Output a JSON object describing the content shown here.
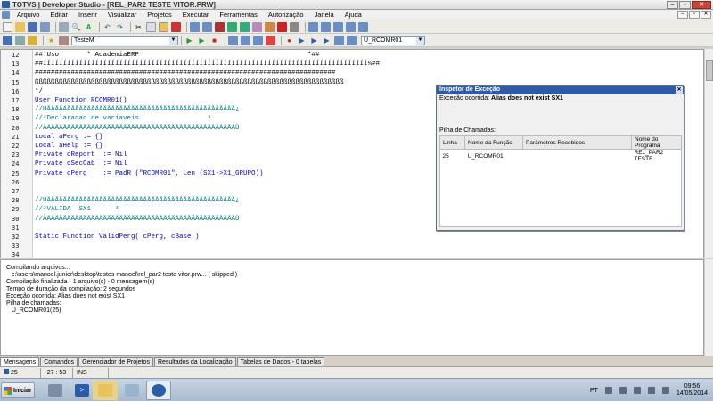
{
  "window": {
    "title": "TOTVS | Developer Studio - [REL_PAR2 TESTE VITOR.PRW]",
    "controls": [
      "–",
      "▫",
      "✕"
    ]
  },
  "menu": [
    "Arquivo",
    "Editar",
    "Inserir",
    "Visualizar",
    "Projetos",
    "Executar",
    "Ferramentas",
    "Autorização",
    "Janela",
    "Ajuda"
  ],
  "toolbar": {
    "environment_value": "TesteM",
    "function_value": "U_RCOMR01"
  },
  "editor": {
    "lines": [
      {
        "n": "12",
        "text": "##'Uso       * AcademiaERP                                          *##",
        "color": "#000000"
      },
      {
        "n": "13",
        "text": "##ÍÍÍÍÍÍÍÍÍÍÍÍÍÍÍÍÍÍÍÍÍÍÍÍÍÍÍÍÍÍÍÍÍÍÍÍÍÍÍÍÍÍÍÍÍÍÍÍÍÍÍÍÍÍÍÍÍÍÍÍÍÍÍÍÍÍÍÍÍÍÍÍÍÍÍÍÍÍÍÍÍ¼##",
        "color": "#000000"
      },
      {
        "n": "14",
        "text": "###########################################################################",
        "color": "#000000"
      },
      {
        "n": "15",
        "text": "ßßßßßßßßßßßßßßßßßßßßßßßßßßßßßßßßßßßßßßßßßßßßßßßßßßßßßßßßßßßßßßßßßßßßßßßßßßßßß",
        "color": "#000000"
      },
      {
        "n": "16",
        "text": "*/",
        "color": "#000000"
      },
      {
        "n": "17",
        "text": "User Function RCOMR01()",
        "color": "#0000c8"
      },
      {
        "n": "18",
        "text": "//ÚÄÄÄÄÄÄÄÄÄÄÄÄÄÄÄÄÄÄÄÄÄÄÄÄÄÄÄÄÄÄÄÄÄÄÄÄÄÄÄÄÄÄÄÄÄÄÄ¿",
        "color": "#007a7a"
      },
      {
        "n": "19",
        "text": "//³Declaracao de variaveis                 ³",
        "color": "#007a7a"
      },
      {
        "n": "20",
        "text": "//ÀÄÄÄÄÄÄÄÄÄÄÄÄÄÄÄÄÄÄÄÄÄÄÄÄÄÄÄÄÄÄÄÄÄÄÄÄÄÄÄÄÄÄÄÄÄÄÄÙ",
        "color": "#007a7a"
      },
      {
        "n": "21",
        "text": "Local aPerg := {}",
        "color": "#0000c8"
      },
      {
        "n": "22",
        "text": "Local aHelp := {}",
        "color": "#0000c8"
      },
      {
        "n": "23",
        "text": "Private oReport  := Nil",
        "color": "#0000c8"
      },
      {
        "n": "24",
        "text": "Private oSecCab  := Nil",
        "color": "#0000c8"
      },
      {
        "n": "25",
        "text": "Private cPerg    := PadR (\"RCOMR01\", Len (SX1->X1_GRUPO))",
        "color": "#0000c8"
      },
      {
        "n": "26",
        "text": "",
        "color": "#000000"
      },
      {
        "n": "27",
        "text": "",
        "color": "#000000"
      },
      {
        "n": "28",
        "text": "//ÚÄÄÄÄÄÄÄÄÄÄÄÄÄÄÄÄÄÄÄÄÄÄÄÄÄÄÄÄÄÄÄÄÄÄÄÄÄÄÄÄÄÄÄÄÄÄÄ¿",
        "color": "#007a7a"
      },
      {
        "n": "29",
        "text": "//³VALIDA  SX1      ³",
        "color": "#007a7a"
      },
      {
        "n": "30",
        "text": "//ÀÄÄÄÄÄÄÄÄÄÄÄÄÄÄÄÄÄÄÄÄÄÄÄÄÄÄÄÄÄÄÄÄÄÄÄÄÄÄÄÄÄÄÄÄÄÄÄÙ",
        "color": "#007a7a"
      },
      {
        "n": "31",
        "text": "",
        "color": "#000000"
      },
      {
        "n": "32",
        "text": "Static Function ValidPerg( cPerg, cBase )",
        "color": "#0000c8"
      },
      {
        "n": "33",
        "text": "",
        "color": "#000000"
      },
      {
        "n": "34",
        "text": "",
        "color": "#000000"
      }
    ]
  },
  "inspector": {
    "title": "Inspetor de Exceção",
    "message_prefix": "Exceção ocorrida:",
    "message": "Alias does not exist SX1",
    "stack_label": "Pilha de Chamadas:",
    "columns": [
      "Linha",
      "Nome da Função",
      "Parâmetros Recebidos",
      "Nome do Programa"
    ],
    "rows": [
      {
        "linha": "25",
        "funcao": "U_RCOMR01",
        "params": "",
        "programa": "REL_PAR2 TESTE"
      }
    ]
  },
  "output": {
    "lines": [
      "Compilando arquivos...",
      "   c:\\users\\manoel.junior\\desktop\\testes manoel\\rel_par2 teste vitor.prw... ( skipped )",
      "Compilação finalizada - 1 arquivo(s) - 0 mensagem(s)",
      "",
      "Tempo de duração da compilação: 2 segundos",
      "",
      "Exceção ocorrida: Alias does not exist SX1",
      "",
      "Pilha de chamadas:",
      "   U_RCOMR01(25)"
    ]
  },
  "tabs": [
    "Mensagens",
    "Comandos",
    "Gerenciador de Projetos",
    "Resultados da Localização",
    "Tabelas de Dados - 0 tabelas"
  ],
  "status": {
    "line": "25",
    "position": "27 : 53",
    "mode": "INS"
  },
  "taskbar": {
    "start_label": "Iniciar",
    "language": "PT",
    "time": "09:56",
    "date": "14/05/2014"
  },
  "colors": {
    "inspector_title_bg": "#2e5aa6",
    "keyword_blue": "#0000c8",
    "comment_teal": "#007a7a"
  }
}
